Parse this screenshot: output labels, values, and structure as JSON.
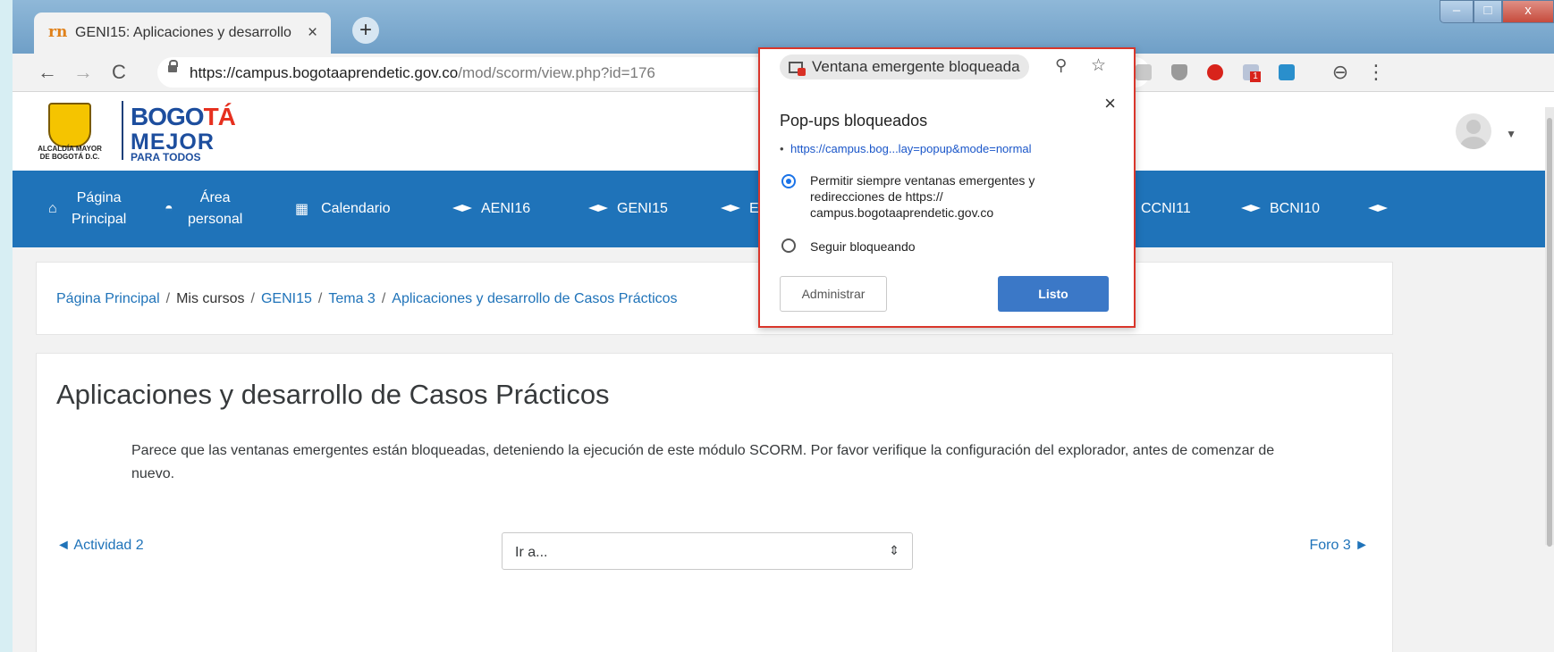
{
  "browser": {
    "tab_title": "GENI15: Aplicaciones y desarrollo",
    "tab_favicon": "rn",
    "new_tab": "+",
    "url_domain": "https://campus.bogotaaprendetic.gov.co",
    "url_path": "/mod/scorm/view.php?id=176",
    "blocked_chip": "Ventana emergente bloqueada",
    "extension_badge": "1"
  },
  "header": {
    "crest_text": "ALCALDÍA MAYOR DE BOGOTÁ D.C.",
    "logo_line1": "BOGO",
    "logo_accent": "TÁ",
    "logo_line2": "MEJOR",
    "logo_line3": "PARA TODOS"
  },
  "nav": {
    "home": "Página Principal",
    "dashboard": "Área personal",
    "calendar": "Calendario",
    "aeni16": "AENI16",
    "geni15": "GENI15",
    "e_partial": "E",
    "ccni11": "CCNI11",
    "bcni10": "BCNI10"
  },
  "breadcrumb": {
    "home": "Página Principal",
    "my_courses": "Mis cursos",
    "course": "GENI15",
    "topic": "Tema 3",
    "current": "Aplicaciones y desarrollo de Casos Prácticos",
    "sep": "/"
  },
  "main": {
    "title": "Aplicaciones y desarrollo de Casos Prácticos",
    "notice": "Parece que las ventanas emergentes están bloqueadas, deteniendo la ejecución de este módulo SCORM. Por favor verifique la configuración del explorador, antes de comenzar de nuevo.",
    "prev": "◄ Actividad 2",
    "next": "Foro 3 ►",
    "jump_placeholder": "Ir a..."
  },
  "popup": {
    "title": "Pop-ups bloqueados",
    "link": "https://campus.bog...lay=popup&mode=normal",
    "option_allow": "Permitir siempre ventanas emergentes y redirecciones de https:// campus.bogotaaprendetic.gov.co",
    "option_block": "Seguir bloqueando",
    "manage": "Administrar",
    "done": "Listo"
  }
}
